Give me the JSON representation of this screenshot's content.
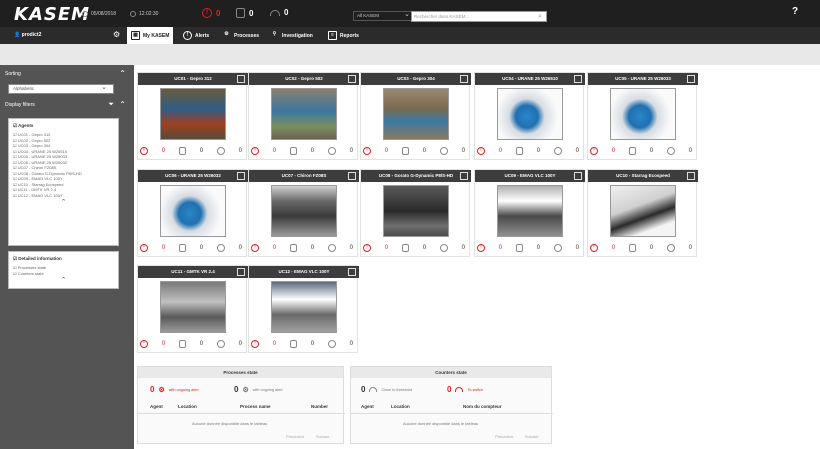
{
  "app": {
    "logo": "KASEM",
    "date": "05/08/2018",
    "time": "12:02:30",
    "alerts_count": "0",
    "processes_count": "0",
    "counters_count": "0",
    "agent_filter": "All KASEM",
    "search_placeholder": "Rechercher dans KASEM...",
    "help": "?"
  },
  "nav": {
    "user": "prodict2",
    "tabs": [
      {
        "label": "My KASEM"
      },
      {
        "label": "Alerts"
      },
      {
        "label": "Processes"
      },
      {
        "label": "Investigation"
      },
      {
        "label": "Reports"
      }
    ]
  },
  "sidebar": {
    "sorting_label": "Sorting",
    "sort_value": "Alphabetic",
    "filters_label": "Display filters",
    "agents_title": "Agents",
    "agents": [
      "UC01 - Gepro 312",
      "UC02 - Gepro 502",
      "UC03 - Gepro 304",
      "UC04 - URANE 25 W26510",
      "UC05 - URANE 25 W26033",
      "UC06 - URANE 25 W26032",
      "UC07 - Chiron FZ08S",
      "UC08 - Gorato G-Dynamic P8/S-HD",
      "UC09 - EMAG VLC 100Y",
      "UC10 - Starrag Ecospeed",
      "UC11 - GMTK VR 2.4",
      "UC12 - EMAG VLC 100Y"
    ],
    "detailed_title": "Detailed information",
    "detailed_items": [
      "Processes state",
      "Counters state"
    ]
  },
  "cards": [
    {
      "title": "UC01 - Gepro 312",
      "alerts": "0",
      "processes": "0",
      "counters": "0"
    },
    {
      "title": "UC02 - Gepro 502",
      "alerts": "0",
      "processes": "0",
      "counters": "0"
    },
    {
      "title": "UC03 - Gepro 304",
      "alerts": "0",
      "processes": "0",
      "counters": "0"
    },
    {
      "title": "UC04 - URANE 25 W26510",
      "alerts": "0",
      "processes": "0",
      "counters": "0"
    },
    {
      "title": "UC05 - URANE 25 W26033",
      "alerts": "0",
      "processes": "0",
      "counters": "0"
    },
    {
      "title": "UC06 - URANE 25 W26032",
      "alerts": "0",
      "processes": "0",
      "counters": "0"
    },
    {
      "title": "UC07 - Chiron FZ08S",
      "alerts": "0",
      "processes": "0",
      "counters": "0"
    },
    {
      "title": "UC08 - Gorato G-Dynamic P8/S-HD",
      "alerts": "0",
      "processes": "0",
      "counters": "0"
    },
    {
      "title": "UC09 - EMAG VLC 100Y",
      "alerts": "0",
      "processes": "0",
      "counters": "0"
    },
    {
      "title": "UC10 - Starrag Ecospeed",
      "alerts": "0",
      "processes": "0",
      "counters": "0"
    },
    {
      "title": "UC11 - GMTK VR 2.4",
      "alerts": "0",
      "processes": "0",
      "counters": "0"
    },
    {
      "title": "UC12 - EMAG VLC 100Y",
      "alerts": "0",
      "processes": "0",
      "counters": "0"
    }
  ],
  "processes_state": {
    "title": "Processes state",
    "ongoing_alert_count": "0",
    "ongoing_alert_label": "with ongoing alert",
    "ongoing_count": "0",
    "ongoing_label": "with ongoing alert",
    "columns": [
      "Agent",
      "Location",
      "Process name",
      "Number"
    ],
    "empty": "Aucune donnée disponible dans le tableau",
    "prev": "Précédent",
    "next": "Suivant"
  },
  "counters_state": {
    "title": "Counters state",
    "threshold_count": "0",
    "threshold_label": "Close to threshold",
    "switch_count": "0",
    "switch_label": "To switch",
    "columns": [
      "Agent",
      "Location",
      "Nom du compteur"
    ],
    "empty": "Aucune donnée disponible dans le tableau",
    "prev": "Précédent",
    "next": "Suivant"
  },
  "colors": {
    "topbar": "#1f1f1f",
    "navbar": "#2b2b2b",
    "sidebar": "#545454",
    "card_header": "#3d3d3d",
    "alert_red": "#e02020"
  }
}
